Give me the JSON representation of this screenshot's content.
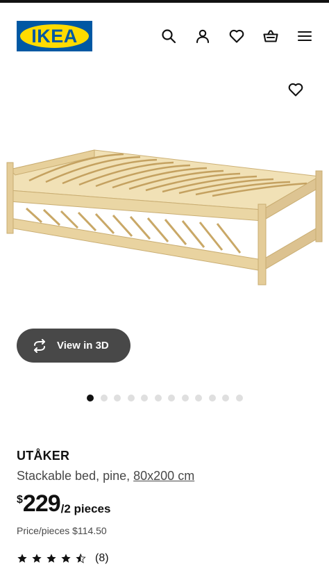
{
  "header": {
    "logo_text": "IKEA",
    "icons": [
      "search-icon",
      "user-icon",
      "heart-icon",
      "basket-icon",
      "menu-icon"
    ]
  },
  "gallery": {
    "view_3d_label": "View in 3D",
    "total_images": 12,
    "active_index": 0
  },
  "product": {
    "name": "UTÅKER",
    "description": "Stackable bed, pine,",
    "size": "80x200 cm",
    "price_currency": "$",
    "price_amount": "229",
    "price_unit": "/2 pieces",
    "price_per_piece": "Price/pieces $114.50",
    "rating_value": 4.5,
    "rating_max": 5,
    "review_count": "(8)"
  },
  "colors": {
    "brand_blue": "#0058a3",
    "brand_yellow": "#ffdb00",
    "button_dark": "#484848",
    "text_primary": "#111111"
  }
}
